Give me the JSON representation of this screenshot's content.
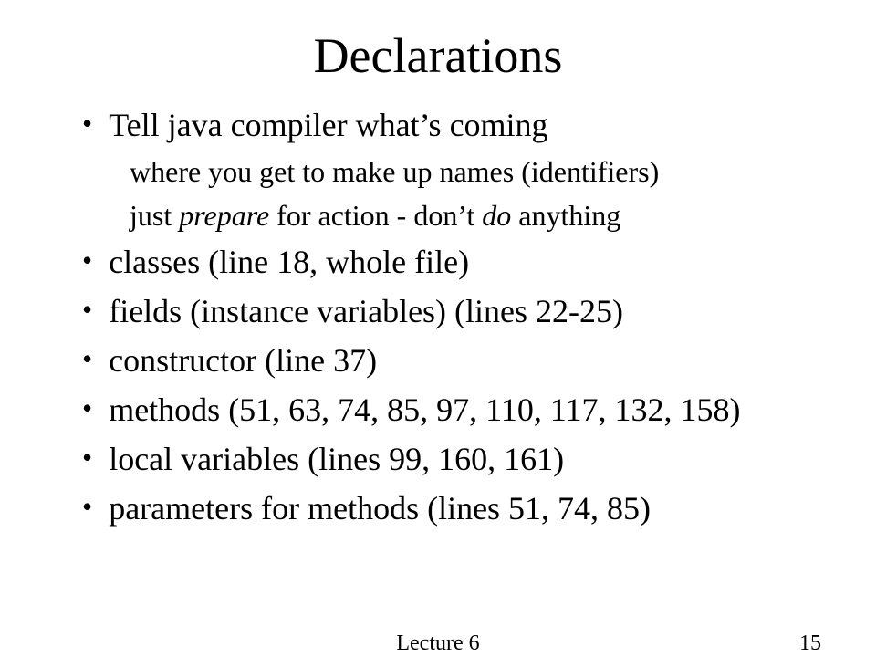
{
  "title": "Declarations",
  "bullets": [
    {
      "text": "Tell java compiler what’s coming",
      "subs": [
        {
          "pre": "where you get to make up names (identifiers)"
        },
        {
          "pre": "just ",
          "i1": "prepare",
          "mid": " for action - don’t ",
          "i2": "do",
          "post": " anything"
        }
      ]
    },
    {
      "text": "classes (line 18, whole file)"
    },
    {
      "text": "fields (instance variables) (lines 22-25)"
    },
    {
      "text": "constructor  (line 37)"
    },
    {
      "text": "methods (51, 63, 74, 85, 97, 110, 117, 132, 158)"
    },
    {
      "text": "local variables (lines 99, 160, 161)"
    },
    {
      "text": "parameters for methods (lines 51, 74, 85)"
    }
  ],
  "footer": {
    "center": "Lecture 6",
    "page": "15"
  }
}
